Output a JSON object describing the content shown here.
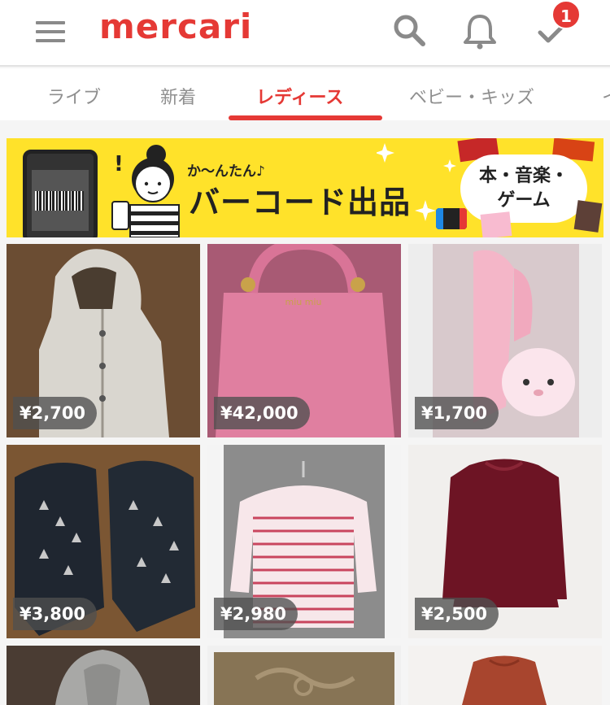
{
  "header": {
    "logo_text": "mercari",
    "menu_icon": "hamburger-menu-icon",
    "search_icon": "search-icon",
    "notification_icon": "bell-icon",
    "todo_icon": "checkmark-icon",
    "todo_badge_count": "1",
    "brand_color": "#e53935"
  },
  "tabs": [
    {
      "label": "ライブ",
      "active": false
    },
    {
      "label": "新着",
      "active": false
    },
    {
      "label": "レディース",
      "active": true
    },
    {
      "label": "ベビー・キッズ",
      "active": false
    },
    {
      "label": "イ",
      "active": false
    }
  ],
  "banner": {
    "small_text": "か〜んたん♪",
    "big_text": "バーコード出品",
    "category_line1": "本・音楽・",
    "category_line2": "ゲーム",
    "background_color": "#ffe22a"
  },
  "products": [
    {
      "price": "¥2,700",
      "image": "white quilted hooded jacket"
    },
    {
      "price": "¥42,000",
      "image": "pink leather handbag"
    },
    {
      "price": "¥1,700",
      "image": "pink plush scarf with character"
    },
    {
      "price": "¥3,800",
      "image": "black studded sneakers"
    },
    {
      "price": "¥2,980",
      "image": "red striped boat-neck top"
    },
    {
      "price": "¥2,500",
      "image": "burgundy velvet dress"
    },
    {
      "price": "",
      "image": "grey knit hooded top"
    },
    {
      "price": "",
      "image": "brown woven mat"
    },
    {
      "price": "",
      "image": "red knit sweater"
    }
  ]
}
